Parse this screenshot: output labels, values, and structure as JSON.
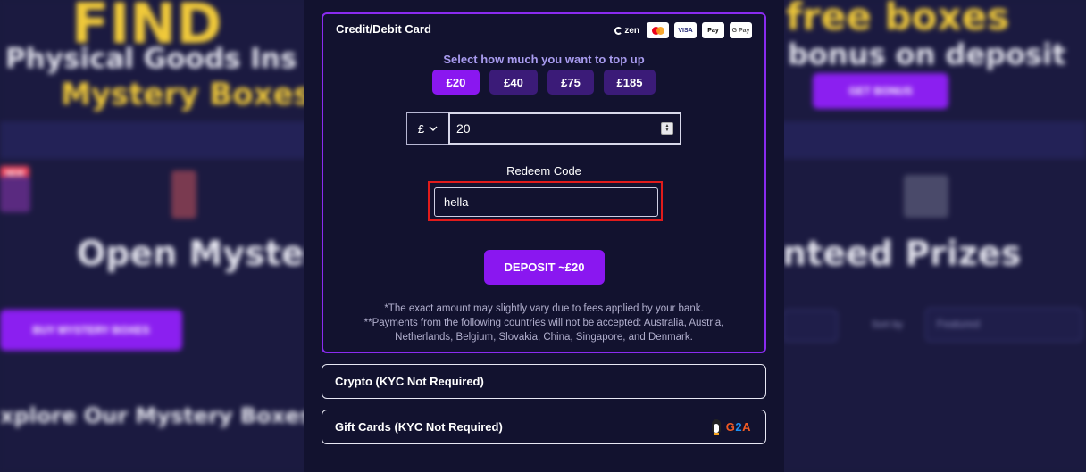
{
  "background": {
    "hero_left_big": "FIND",
    "hero_left_line1": "Physical Goods Ins",
    "hero_left_line2": "Mystery Boxes",
    "hero_right_line1": "free boxes",
    "hero_right_line2": "bonus on deposit",
    "get_bonus": "GET BONUS",
    "open_mystery": "Open Myster",
    "guaranteed_prizes": "nteed Prizes",
    "buy_boxes": "BUY MYSTERY BOXES",
    "explore": "xplore Our Mystery Boxes fo",
    "sort_by": "Sort by",
    "featured": "Featured",
    "tag_new": "NEW"
  },
  "payment": {
    "card": {
      "title": "Credit/Debit Card",
      "zen_label": "zen",
      "visa_label": "VISA",
      "apple_pay_label": "Pay",
      "gpay_label": "G Pay",
      "subtitle": "Select how much you want to top up",
      "amounts": [
        "£20",
        "£40",
        "£75",
        "£185"
      ],
      "selected_amount_index": 0,
      "currency_symbol": "£",
      "amount_value": "20",
      "redeem_label": "Redeem Code",
      "redeem_value": "hella",
      "deposit_label": "DEPOSIT ~£20",
      "disclaimer_1": "*The exact amount may slightly vary due to fees applied by your bank.",
      "disclaimer_2": "**Payments from the following countries will not be accepted: Australia, Austria,",
      "disclaimer_3": "Netherlands, Belgium, Slovakia, China, Singapore, and Denmark."
    },
    "crypto": {
      "title": "Crypto (KYC Not Required)"
    },
    "gift_cards": {
      "title": "Gift Cards (KYC Not Required)",
      "g2a_label_g": "G",
      "g2a_label_2": "2",
      "g2a_label_a": "A"
    }
  },
  "colors": {
    "accent": "#8a17f0",
    "amount_unselected": "#3b1b78",
    "highlight": "#e11b1b",
    "modal_bg": "#12122f"
  }
}
